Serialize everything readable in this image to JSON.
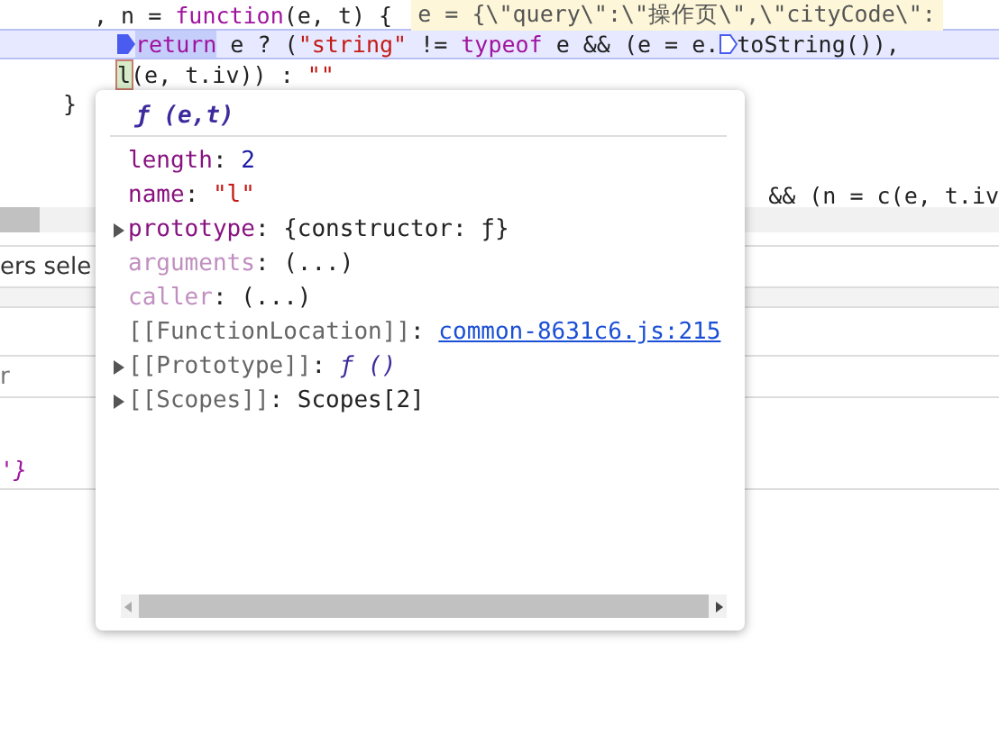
{
  "code_lines": [
    {
      "current": false,
      "kind": "declaration",
      "tokens": [
        {
          "t": ", n = ",
          "kind": "plain"
        },
        {
          "t": "function",
          "kind": "kw"
        },
        {
          "t": "(e, t) {",
          "kind": "plain"
        },
        {
          "t": "e = {\\\"query\\\":\\\"操作页\\\",\\\"cityCode\\\":",
          "kind": "inline-value"
        }
      ]
    },
    {
      "current": true,
      "kind": "statement",
      "tokens": [
        {
          "kind": "marker"
        },
        {
          "t": "return",
          "kind": "kw-hl"
        },
        {
          "t": " e ? (",
          "kind": "plain"
        },
        {
          "t": "\"string\"",
          "kind": "str"
        },
        {
          "t": " != ",
          "kind": "plain"
        },
        {
          "t": "typeof",
          "kind": "kw"
        },
        {
          "t": " e && (e = e.",
          "kind": "plain"
        },
        {
          "kind": "marker-outline"
        },
        {
          "t": "toString()),",
          "kind": "plain"
        }
      ]
    },
    {
      "current": false,
      "kind": "statement",
      "tokens": [
        {
          "t": "l",
          "kind": "hover"
        },
        {
          "t": "(e, t.iv)) : ",
          "kind": "plain"
        },
        {
          "t": "\"\"",
          "kind": "str"
        }
      ]
    },
    {
      "current": false,
      "kind": "block-end",
      "tokens": [
        {
          "t": "}",
          "kind": "plain"
        }
      ]
    }
  ],
  "behind": {
    "code_fragment": "&& (n = c(e, t.iv",
    "filter_text": "ers sele",
    "field_text": "r",
    "closing": "'}"
  },
  "popup": {
    "title": "ƒ (e,t)",
    "properties": [
      {
        "key": "length",
        "separator": ":",
        "kind": "prop",
        "expandable": false,
        "value": "2",
        "color": "#1a1aa6"
      },
      {
        "key": "name",
        "separator": ":",
        "kind": "prop",
        "expandable": false,
        "value": "\"l\"",
        "color": "#c41a16"
      },
      {
        "key": "prototype",
        "separator": ":",
        "kind": "prop",
        "expandable": true,
        "value": "{constructor: ƒ}",
        "color": "#222222"
      },
      {
        "key": "arguments",
        "separator": ":",
        "kind": "accessor",
        "expandable": false,
        "value": "(...)",
        "color": "#222222"
      },
      {
        "key": "caller",
        "separator": ":",
        "kind": "accessor",
        "expandable": false,
        "value": "(...)",
        "color": "#222222"
      },
      {
        "key": "[[FunctionLocation]]",
        "separator": ":",
        "kind": "internal-link",
        "expandable": false,
        "value": "common-8631c6.js:215",
        "color": "#1a4fd6"
      },
      {
        "key": "[[Prototype]]",
        "separator": ":",
        "kind": "internal-function",
        "expandable": true,
        "value": "ƒ ()",
        "color": "#3c2b9c"
      },
      {
        "key": "[[Scopes]]",
        "separator": ":",
        "kind": "internal",
        "expandable": true,
        "value": "Scopes[2]",
        "color": "#222222"
      }
    ]
  }
}
